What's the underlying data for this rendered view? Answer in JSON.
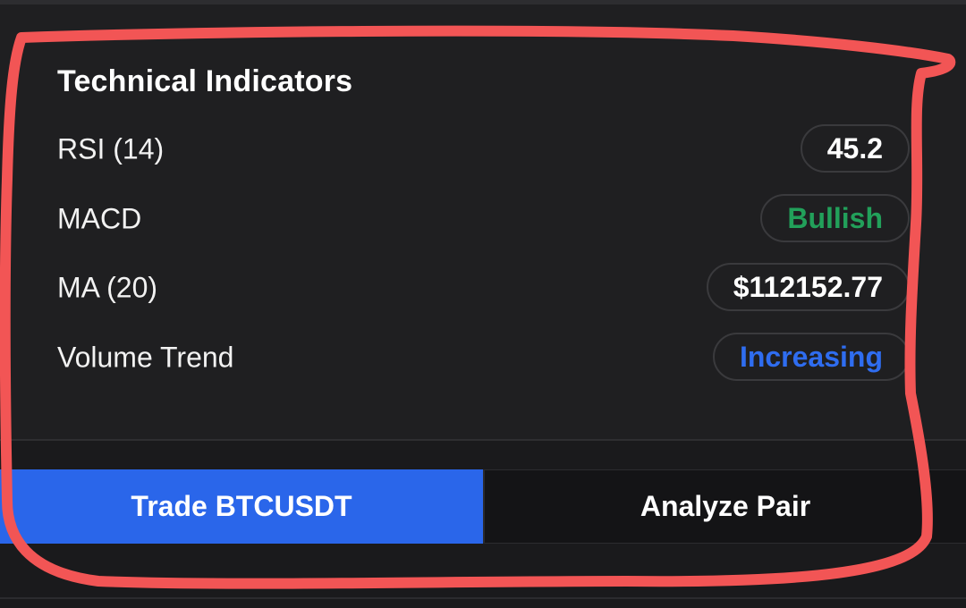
{
  "panel": {
    "title": "Technical Indicators",
    "indicators": [
      {
        "label": "RSI (14)",
        "value": "45.2",
        "value_color": "#ffffff"
      },
      {
        "label": "MACD",
        "value": "Bullish",
        "value_color": "#22a05a"
      },
      {
        "label": "MA (20)",
        "value": "$112152.77",
        "value_color": "#ffffff"
      },
      {
        "label": "Volume Trend",
        "value": "Increasing",
        "value_color": "#2f6df0"
      }
    ]
  },
  "actions": {
    "trade_label": "Trade BTCUSDT",
    "analyze_label": "Analyze Pair"
  },
  "colors": {
    "primary": "#2a66ea",
    "highlight_annotation": "#f25555"
  }
}
